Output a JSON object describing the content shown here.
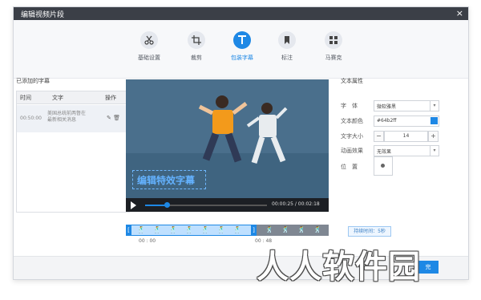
{
  "window": {
    "title": "编辑视频片段",
    "close": "×"
  },
  "toolbar": {
    "tools": [
      {
        "label": "基础设置",
        "icon": "scissors-icon"
      },
      {
        "label": "裁剪",
        "icon": "crop-icon"
      },
      {
        "label": "包装字幕",
        "icon": "text-icon",
        "active": true
      },
      {
        "label": "标注",
        "icon": "bookmark-icon"
      },
      {
        "label": "马赛克",
        "icon": "mosaic-icon"
      }
    ]
  },
  "subtitles": {
    "title": "已添加的字幕",
    "headers": {
      "time": "时间",
      "text": "文字",
      "action": "操作"
    },
    "rows": [
      {
        "time": "00:50:00",
        "text": "美国总统前两督在最新相关消息"
      }
    ]
  },
  "video": {
    "caption": "编辑特效字幕",
    "timecode": "00:00:25 / 00:02:18",
    "progress_fraction": 0.18
  },
  "props": {
    "title": "文本属性",
    "font_label": "字　体",
    "font_value": "微软雅黑",
    "color_label": "文本颜色",
    "color_value": "#64b2ff",
    "size_label": "文字大小",
    "size_value": "14",
    "effect_label": "动画效果",
    "effect_value": "无效果",
    "position_label": "位　置"
  },
  "timeline": {
    "start": "00 : 00",
    "end": "00 : 48",
    "duration": "持续时间：5秒"
  },
  "footer": {
    "done": "完"
  },
  "watermark": "人人软件园",
  "colors": {
    "accent": "#1e88e5",
    "titlebar": "#3b3f47",
    "caption": "#64b2ff"
  }
}
